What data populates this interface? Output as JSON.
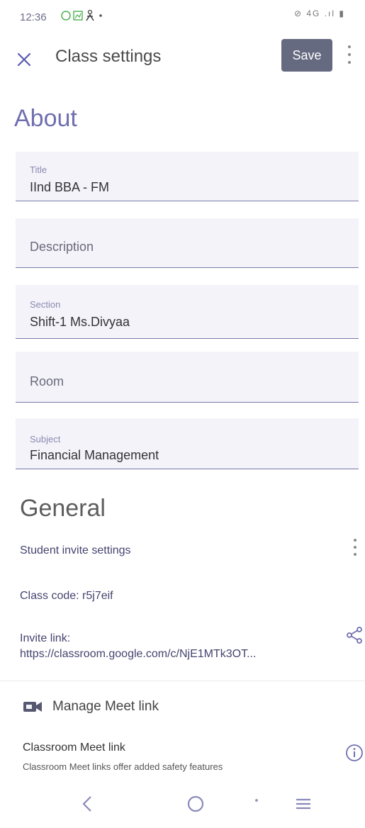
{
  "status_bar": {
    "time": "12:36",
    "right_text": "⊘ 4G .ıl ▮"
  },
  "app_bar": {
    "title": "Class settings",
    "save_label": "Save"
  },
  "about": {
    "heading": "About",
    "fields": {
      "title": {
        "label": "Title",
        "value": "IInd BBA - FM"
      },
      "description": {
        "placeholder": "Description"
      },
      "section": {
        "label": "Section",
        "value": "Shift-1 Ms.Divyaa"
      },
      "room": {
        "placeholder": "Room"
      },
      "subject": {
        "label": "Subject",
        "value": "Financial Management"
      }
    }
  },
  "general": {
    "heading": "General",
    "student_invite_settings": "Student invite settings",
    "class_code": "Class code: r5j7eif",
    "invite_link_label": "Invite link:",
    "invite_link_url": "https://classroom.google.com/c/NjE1MTk3OT...",
    "manage_meet_link": "Manage Meet link",
    "classroom_meet_link_title": "Classroom Meet link",
    "classroom_meet_link_desc": "Classroom Meet links offer added safety features"
  },
  "icons": {
    "close": "close-icon",
    "more": "more-vert-icon",
    "share": "share-icon",
    "video": "video-camera-icon",
    "info": "info-icon",
    "back": "back-icon",
    "home": "home-icon",
    "recents": "recents-icon"
  },
  "colors": {
    "accent": "#6f6fb0",
    "save_button": "#666a80",
    "field_bg": "#f4f3fa",
    "field_underline": "#767aa8"
  }
}
